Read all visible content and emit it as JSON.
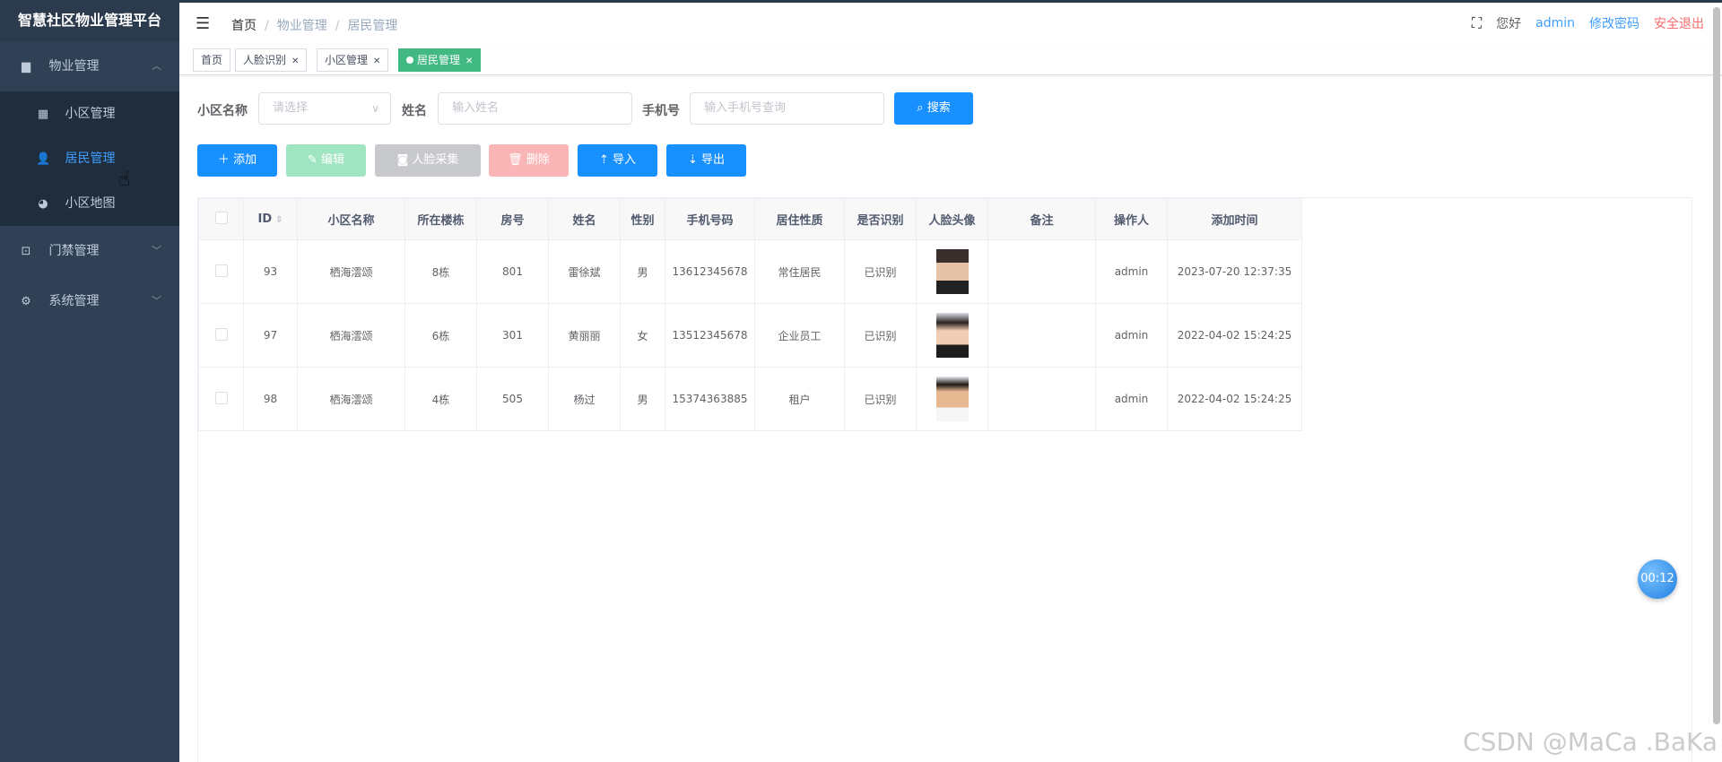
{
  "app": {
    "title": "智慧社区物业管理平台"
  },
  "sidebar": {
    "groups": [
      {
        "label": "物业管理",
        "icon": "folder-icon",
        "expanded": true,
        "items": [
          {
            "label": "小区管理",
            "icon": "grid-icon"
          },
          {
            "label": "居民管理",
            "icon": "user-icon",
            "active": true
          },
          {
            "label": "小区地图",
            "icon": "globe-icon"
          }
        ]
      },
      {
        "label": "门禁管理",
        "icon": "monitor-icon",
        "expanded": false
      },
      {
        "label": "系统管理",
        "icon": "gear-icon",
        "expanded": false
      }
    ]
  },
  "header": {
    "breadcrumb": [
      "首页",
      "物业管理",
      "居民管理"
    ],
    "greeting": "您好",
    "user": "admin",
    "change_password": "修改密码",
    "logout": "安全退出"
  },
  "tags": [
    {
      "label": "首页",
      "closable": false,
      "active": false
    },
    {
      "label": "人脸识别",
      "closable": true,
      "active": false
    },
    {
      "label": "小区管理",
      "closable": true,
      "active": false
    },
    {
      "label": "居民管理",
      "closable": true,
      "active": true
    }
  ],
  "filters": {
    "community_label": "小区名称",
    "community_placeholder": "请选择",
    "name_label": "姓名",
    "name_placeholder": "输入姓名",
    "phone_label": "手机号",
    "phone_placeholder": "输入手机号查询",
    "search_button": "搜索"
  },
  "toolbar": {
    "add": "添加",
    "edit": "编辑",
    "face_capture": "人脸采集",
    "delete": "删除",
    "import": "导入",
    "export": "导出"
  },
  "table": {
    "columns": [
      "ID",
      "小区名称",
      "所在楼栋",
      "房号",
      "姓名",
      "性别",
      "手机号码",
      "居住性质",
      "是否识别",
      "人脸头像",
      "备注",
      "操作人",
      "添加时间"
    ],
    "rows": [
      {
        "id": "93",
        "community": "栖海澐颂",
        "building": "8栋",
        "room": "801",
        "name": "雷徐斌",
        "gender": "男",
        "phone": "13612345678",
        "residence": "常住居民",
        "recognized": "已识别",
        "avatar": "avatar-female-1",
        "note": "",
        "operator": "admin",
        "added": "2023-07-20 12:37:35"
      },
      {
        "id": "97",
        "community": "栖海澐颂",
        "building": "6栋",
        "room": "301",
        "name": "黄丽丽",
        "gender": "女",
        "phone": "13512345678",
        "residence": "企业员工",
        "recognized": "已识别",
        "avatar": "avatar-female-2",
        "note": "",
        "operator": "admin",
        "added": "2022-04-02 15:24:25"
      },
      {
        "id": "98",
        "community": "栖海澐颂",
        "building": "4栋",
        "room": "505",
        "name": "杨过",
        "gender": "男",
        "phone": "15374363885",
        "residence": "租户",
        "recognized": "已识别",
        "avatar": "avatar-male-1",
        "note": "",
        "operator": "admin",
        "added": "2022-04-02 15:24:25"
      }
    ]
  },
  "timer": "00:12",
  "watermark": "CSDN @MaCa .BaKa",
  "colors": {
    "primary": "#1890ff",
    "sidebar_bg": "#304156",
    "active_tag": "#42b983",
    "logout": "#f56c6c"
  }
}
